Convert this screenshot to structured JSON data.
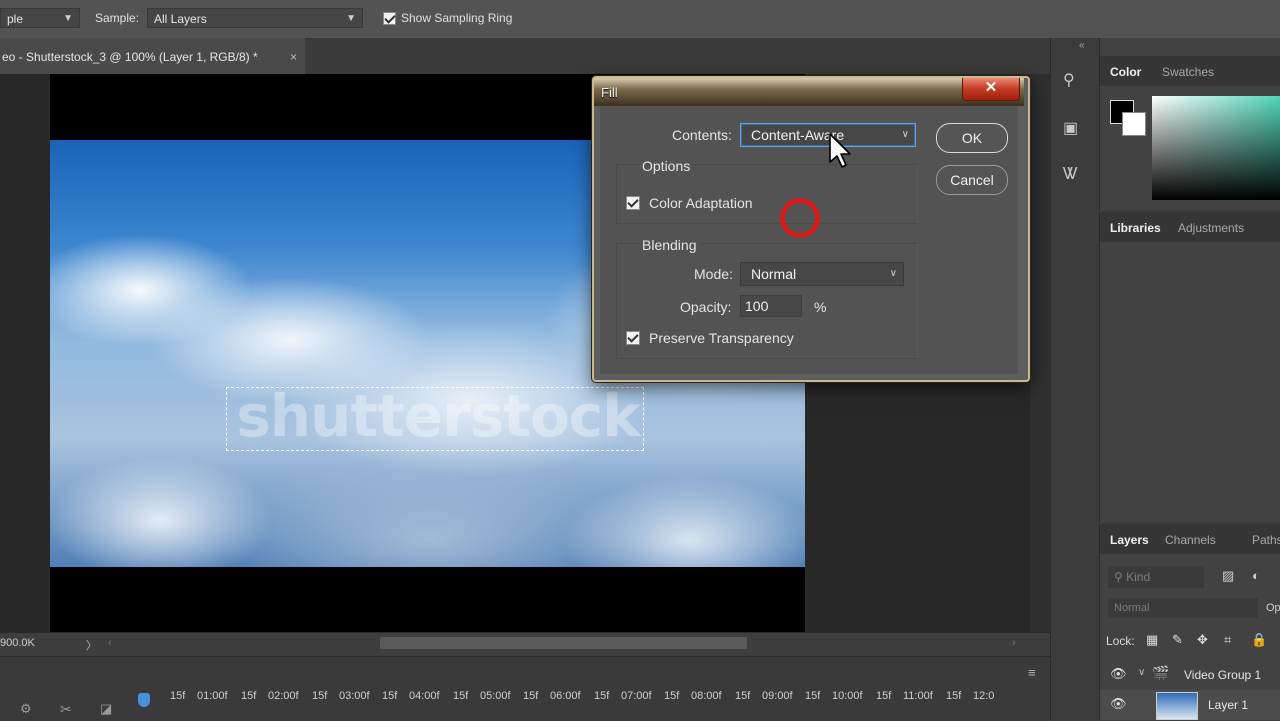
{
  "options_bar": {
    "tool_select_value": "ple",
    "sample_label": "Sample:",
    "sample_value": "All Layers",
    "show_ring_label": "Show Sampling Ring"
  },
  "document": {
    "tab_title": "eo - Shutterstock_3 @ 100% (Layer 1, RGB/8) *",
    "close": "×",
    "watermark_text": "shutterstock"
  },
  "status": {
    "doc_size": "900.0K",
    "arrow": "〉"
  },
  "timeline": {
    "ticks": [
      "15f",
      "01:00f",
      "15f",
      "02:00f",
      "15f",
      "03:00f",
      "15f",
      "04:00f",
      "15f",
      "05:00f",
      "15f",
      "06:00f",
      "15f",
      "07:00f",
      "15f",
      "08:00f",
      "15f",
      "09:00f",
      "15f",
      "10:00f",
      "15f",
      "11:00f",
      "15f",
      "12:0"
    ]
  },
  "panels": {
    "color": {
      "tabs": [
        "Color",
        "Swatches"
      ]
    },
    "libraries": {
      "tabs": [
        "Libraries",
        "Adjustments"
      ]
    },
    "layers": {
      "tabs": [
        "Layers",
        "Channels",
        "Paths"
      ],
      "kind_placeholder": "Kind",
      "blend_mode": "Normal",
      "opacity_label": "Op",
      "lock_label": "Lock:",
      "rows": [
        {
          "name": "Video Group 1"
        },
        {
          "name": "Layer 1"
        }
      ]
    }
  },
  "fill_dialog": {
    "title": "Fill",
    "close": "✕",
    "contents_label": "Contents:",
    "contents_value": "Content-Aware",
    "ok_label": "OK",
    "cancel_label": "Cancel",
    "options_group": "Options",
    "color_adaptation_label": "Color Adaptation",
    "blending_group": "Blending",
    "mode_label": "Mode:",
    "mode_value": "Normal",
    "opacity_label": "Opacity:",
    "opacity_value": "100",
    "opacity_unit": "%",
    "preserve_label": "Preserve Transparency"
  },
  "colors": {
    "accent": "#4a8ede",
    "ring": "#d51a1a"
  }
}
